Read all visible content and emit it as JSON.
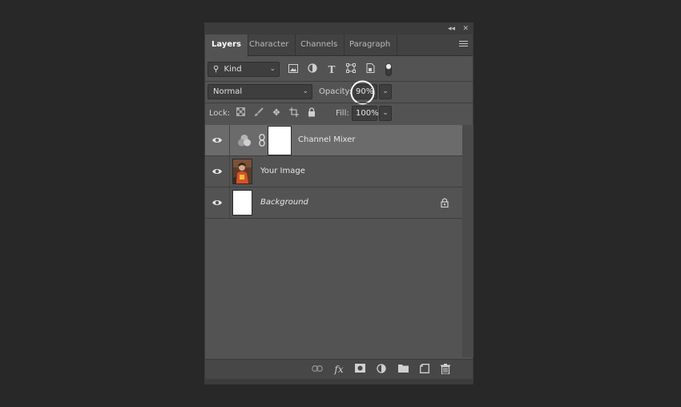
{
  "titlebar": {
    "collapse_glyph": "◂◂",
    "close_glyph": "✕"
  },
  "tabs": [
    {
      "label": "Layers",
      "active": true
    },
    {
      "label": "Character",
      "active": false
    },
    {
      "label": "Channels",
      "active": false
    },
    {
      "label": "Paragraph",
      "active": false
    }
  ],
  "filter": {
    "kind_label": "Kind",
    "icons": [
      "pixel-filter-icon",
      "adjustment-filter-icon",
      "type-filter-icon",
      "shape-filter-icon",
      "smart-object-filter-icon",
      "filter-toggle-icon"
    ]
  },
  "blend": {
    "mode": "Normal",
    "opacity_label": "Opacity:",
    "opacity_value": "90%"
  },
  "lock": {
    "label": "Lock:",
    "fill_label": "Fill:",
    "fill_value": "100%",
    "icons": [
      "lock-transparent-pixels-icon",
      "lock-image-pixels-icon",
      "lock-position-icon",
      "lock-artboard-icon",
      "lock-all-icon"
    ]
  },
  "layers": [
    {
      "name": "Channel Mixer",
      "type": "adjustment",
      "selected": true,
      "visible": true
    },
    {
      "name": "Your Image",
      "type": "image",
      "selected": false,
      "visible": true
    },
    {
      "name": "Background",
      "type": "background",
      "selected": false,
      "visible": true,
      "locked": true
    }
  ],
  "bottom_icons": [
    "link-layers-icon",
    "fx-icon",
    "add-mask-icon",
    "new-adjustment-icon",
    "new-group-icon",
    "new-layer-icon",
    "delete-layer-icon"
  ],
  "bottom_fx_label": "fx",
  "colors": {
    "panel": "#535353",
    "selected_layer": "#6b6b6b",
    "background": "#282828"
  }
}
